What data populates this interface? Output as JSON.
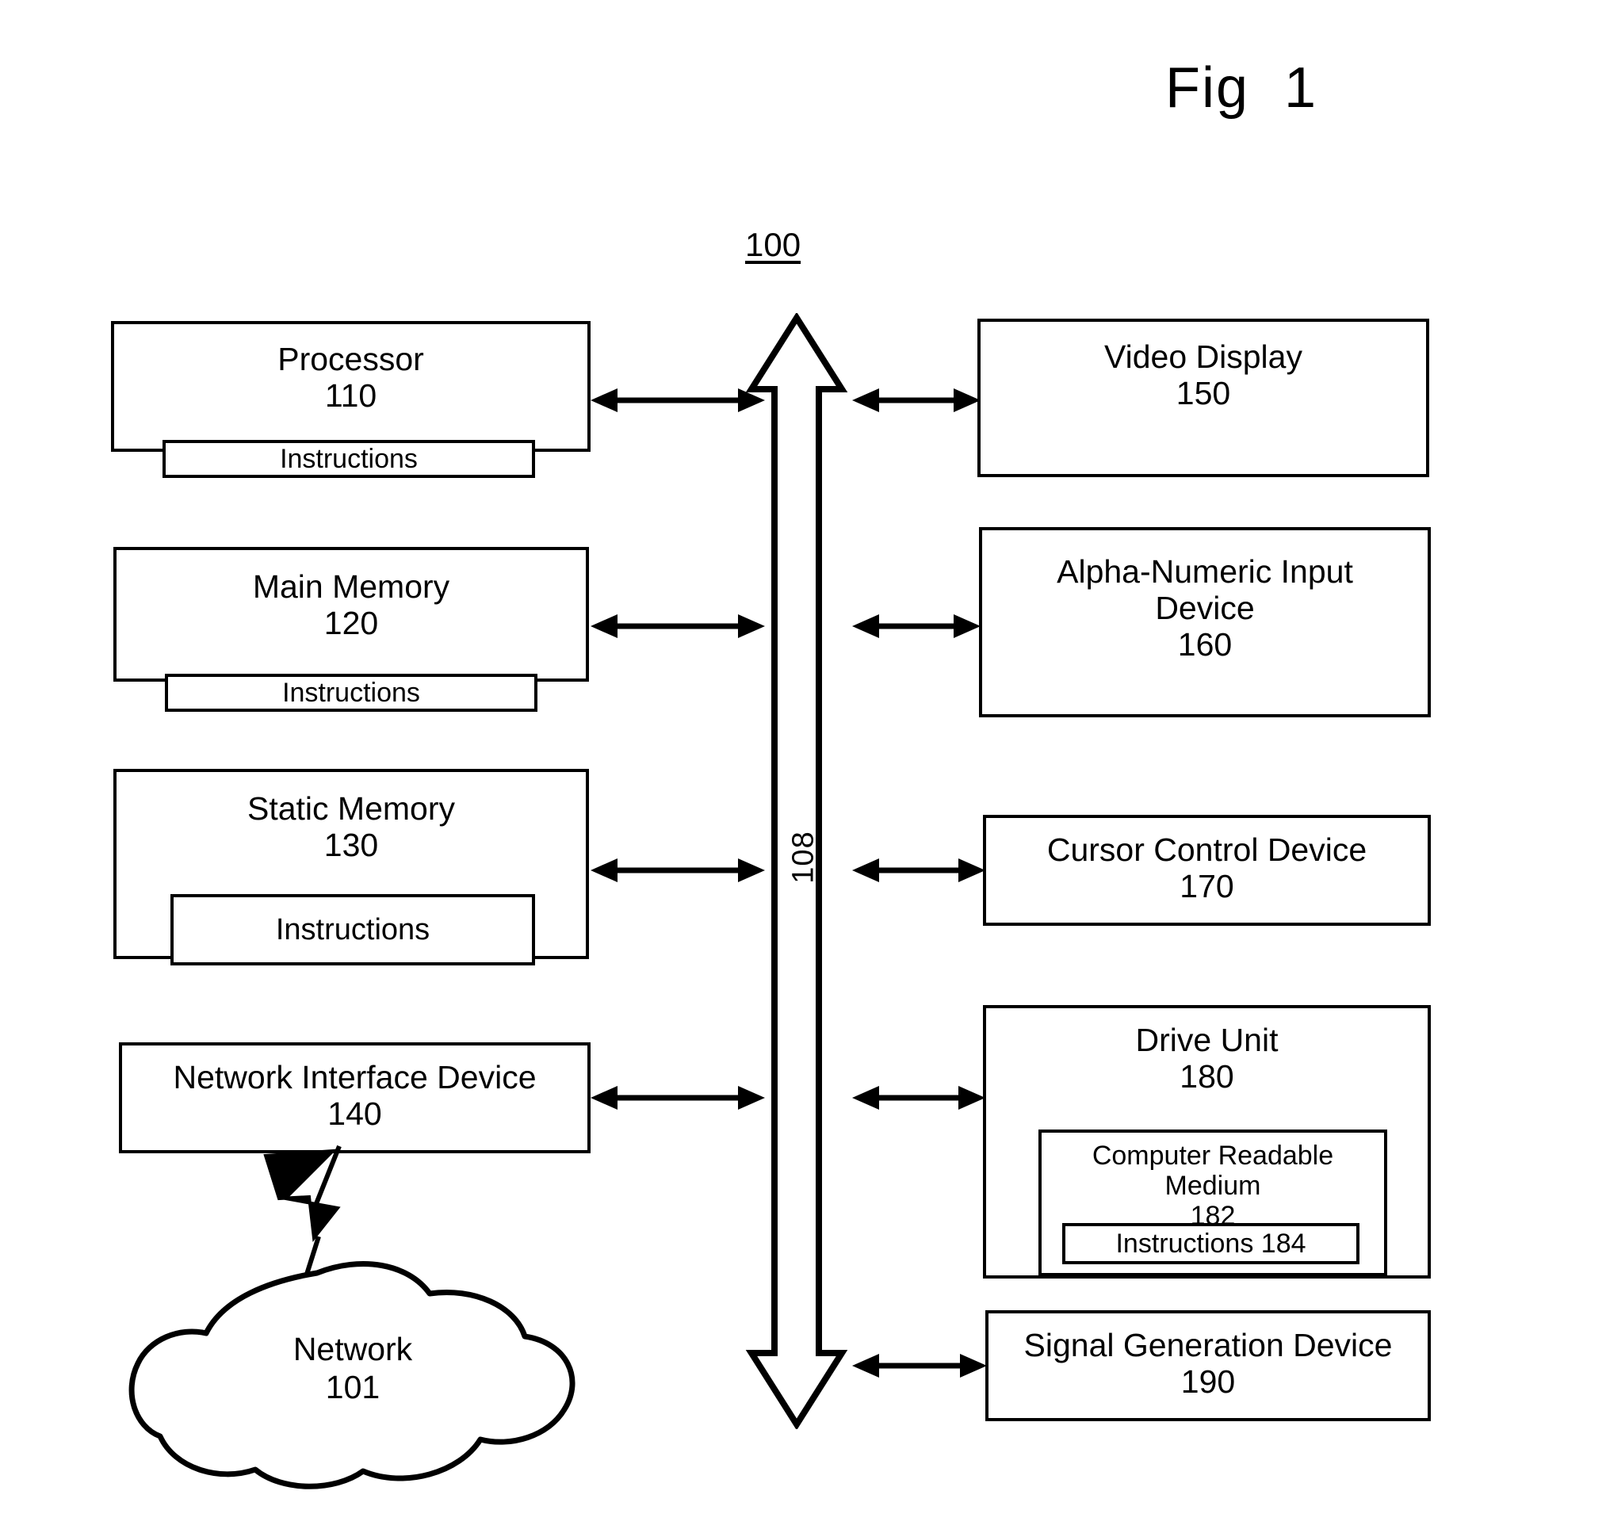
{
  "figure": {
    "title": "Fig  1",
    "system_ref": "100",
    "bus_ref": "108"
  },
  "left_column": {
    "processor": {
      "title": "Processor",
      "number": "110",
      "instructions_label": "Instructions"
    },
    "main_memory": {
      "title": "Main Memory",
      "number": "120",
      "instructions_label": "Instructions"
    },
    "static_memory": {
      "title": "Static Memory",
      "number": "130",
      "instructions_label": "Instructions"
    },
    "network_interface_device": {
      "title": "Network Interface Device",
      "number": "140"
    },
    "network": {
      "title": "Network",
      "number": "101"
    }
  },
  "right_column": {
    "video_display": {
      "title": "Video Display",
      "number": "150"
    },
    "alpha_numeric_input_device": {
      "title": "Alpha-Numeric Input\nDevice",
      "number": "160"
    },
    "cursor_control_device": {
      "title": "Cursor Control Device",
      "number": "170"
    },
    "drive_unit": {
      "title": "Drive Unit",
      "number": "180",
      "computer_readable_medium": {
        "title": "Computer Readable\nMedium",
        "number": "182",
        "instructions_label": "Instructions 184"
      }
    },
    "signal_generation_device": {
      "title": "Signal Generation Device",
      "number": "190"
    }
  },
  "colors": {
    "ink": "#000000",
    "paper": "#ffffff"
  }
}
